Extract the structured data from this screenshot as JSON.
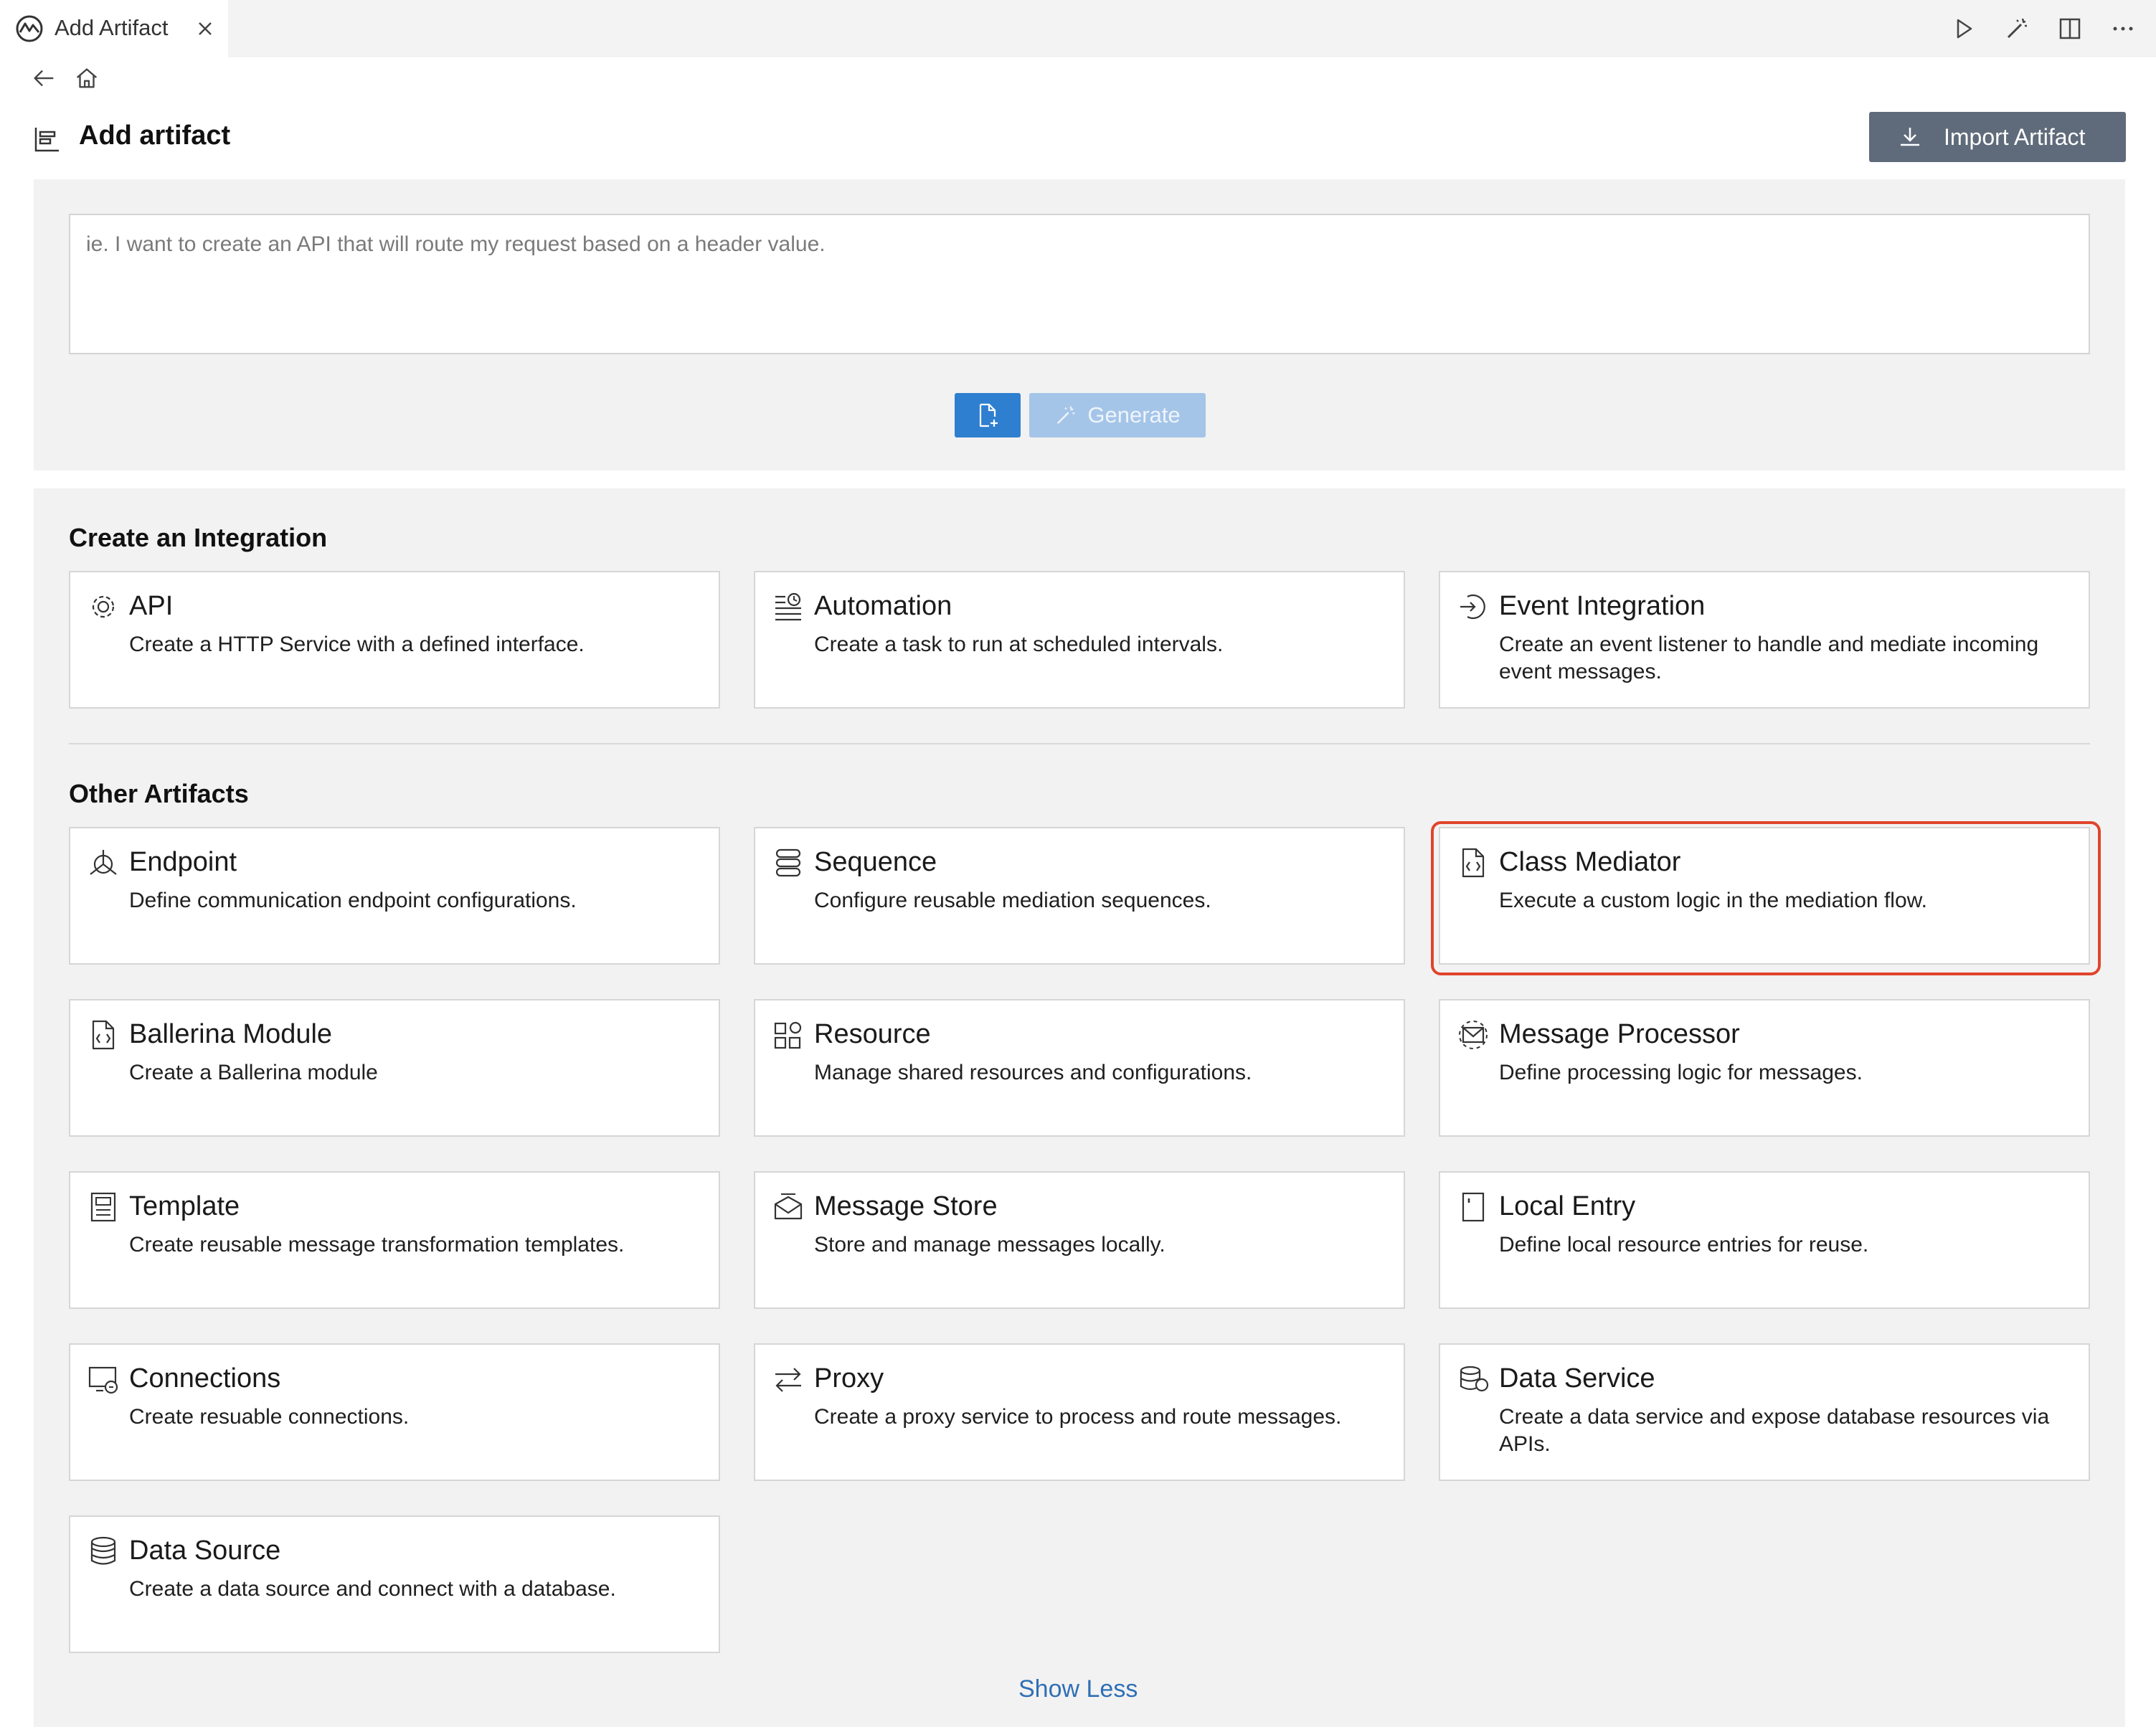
{
  "tab": {
    "title": "Add Artifact"
  },
  "header": {
    "title": "Add artifact",
    "import_label": "Import Artifact"
  },
  "ai": {
    "placeholder": "ie. I want to create an API that will route my request based on a header value.",
    "generate_label": "Generate"
  },
  "integration": {
    "title": "Create an Integration",
    "cards": [
      {
        "title": "API",
        "desc": "Create a HTTP Service with a defined interface.",
        "icon": "gear-icon"
      },
      {
        "title": "Automation",
        "desc": "Create a task to run at scheduled intervals.",
        "icon": "clock-list-icon"
      },
      {
        "title": "Event Integration",
        "desc": "Create an event listener to handle and mediate incoming event messages.",
        "icon": "event-icon"
      }
    ]
  },
  "other": {
    "title": "Other Artifacts",
    "cards": [
      {
        "title": "Endpoint",
        "desc": "Define communication endpoint configurations.",
        "icon": "endpoint-icon"
      },
      {
        "title": "Sequence",
        "desc": "Configure reusable mediation sequences.",
        "icon": "sequence-icon"
      },
      {
        "title": "Class Mediator",
        "desc": "Execute a custom logic in the mediation flow.",
        "icon": "code-file-icon"
      },
      {
        "title": "Ballerina Module",
        "desc": "Create a Ballerina module",
        "icon": "code-file-icon"
      },
      {
        "title": "Resource",
        "desc": "Manage shared resources and configurations.",
        "icon": "resource-icon"
      },
      {
        "title": "Message Processor",
        "desc": "Define processing logic for messages.",
        "icon": "message-processor-icon"
      },
      {
        "title": "Template",
        "desc": "Create reusable message transformation templates.",
        "icon": "template-icon"
      },
      {
        "title": "Message Store",
        "desc": "Store and manage messages locally.",
        "icon": "message-store-icon"
      },
      {
        "title": "Local Entry",
        "desc": "Define local resource entries for reuse.",
        "icon": "local-entry-icon"
      },
      {
        "title": "Connections",
        "desc": "Create resuable connections.",
        "icon": "connections-icon"
      },
      {
        "title": "Proxy",
        "desc": "Create a proxy service to process and route messages.",
        "icon": "proxy-icon"
      },
      {
        "title": "Data Service",
        "desc": "Create a data service and expose database resources via APIs.",
        "icon": "data-service-icon"
      },
      {
        "title": "Data Source",
        "desc": "Create a data source and connect with a database.",
        "icon": "database-icon"
      }
    ]
  },
  "show_less_label": "Show Less",
  "colors": {
    "primary": "#2f7fd0",
    "import_bg": "#5f6b7a",
    "highlight": "#e0452b",
    "link": "#2f6fb5"
  }
}
